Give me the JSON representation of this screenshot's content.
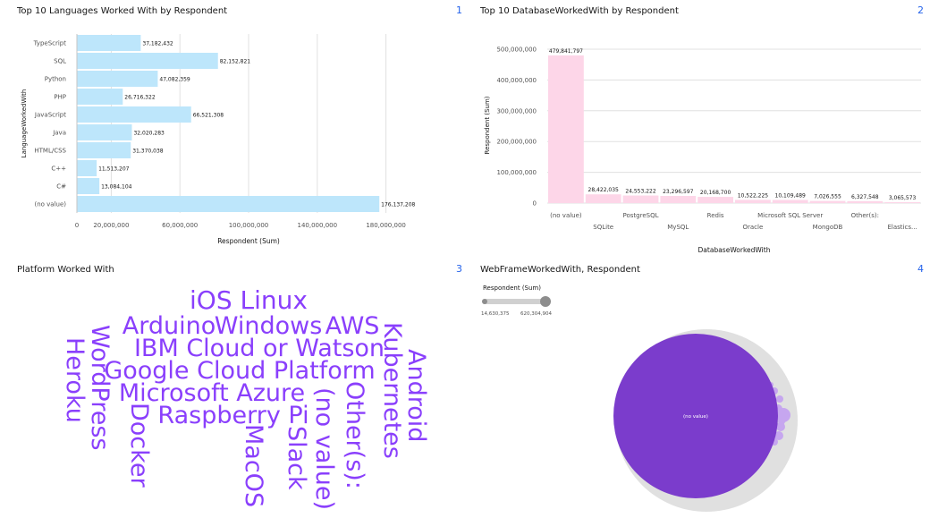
{
  "colors": {
    "bar_blue": "#bde6fb",
    "bar_pink": "#fdd6e8",
    "word_purple": "#8a3ffc",
    "bubble_purple": "#7b3ccc",
    "bubble_light": "#c6a6ef",
    "bubble_outer": "#e0e0e0",
    "panel_number": "#2563eb",
    "grid": "#e0e0e0"
  },
  "panels": [
    {
      "title": "Top 10 Languages Worked With by Respondent",
      "number": "1"
    },
    {
      "title": "Top 10 DatabaseWorkedWith by Respondent",
      "number": "2"
    },
    {
      "title": "Platform Worked With",
      "number": "3"
    },
    {
      "title": "WebFrameWorkedWith, Respondent",
      "number": "4"
    }
  ],
  "chart_data": [
    {
      "type": "bar",
      "orientation": "horizontal",
      "title": "Top 10 Languages Worked With by Respondent",
      "xlabel": "Respondent (Sum)",
      "ylabel": "LanguageWorkedWith",
      "categories": [
        "TypeScript",
        "SQL",
        "Python",
        "PHP",
        "JavaScript",
        "Java",
        "HTML/CSS",
        "C++",
        "C#",
        "(no value)"
      ],
      "values": [
        37182432,
        82152821,
        47082359,
        26716322,
        66521308,
        32020283,
        31370038,
        11513207,
        13084104,
        176137208
      ],
      "value_labels": [
        "37,182,432",
        "82,152,821",
        "47,082,359",
        "26,716,322",
        "66,521,308",
        "32,020,283",
        "31,370,038",
        "11,513,207",
        "13,084,104",
        "176,137,208"
      ],
      "xlim": [
        0,
        200000000
      ],
      "xticks": [
        0,
        20000000,
        60000000,
        100000000,
        140000000,
        180000000
      ],
      "xtick_labels": [
        "0",
        "20,000,000",
        "60,000,000",
        "100,000,000",
        "140,000,000",
        "180,000,000"
      ],
      "grid": true
    },
    {
      "type": "bar",
      "orientation": "vertical",
      "title": "Top 10 DatabaseWorkedWith by Respondent",
      "xlabel": "DatabaseWorkedWith",
      "ylabel": "Respondent (Sum)",
      "categories": [
        "(no value)",
        "SQLite",
        "PostgreSQL",
        "MySQL",
        "Redis",
        "Oracle",
        "Microsoft SQL Server",
        "MongoDB",
        "Other(s):",
        "Elastics..."
      ],
      "values": [
        479841797,
        28422035,
        24553222,
        23296597,
        20168700,
        10522225,
        10109489,
        7026555,
        6327548,
        3065573
      ],
      "value_labels": [
        "479,841,797",
        "28,422,035",
        "24,553,222",
        "23,296,597",
        "20,168,700",
        "10,522,225",
        "10,109,489",
        "7,026,555",
        "6,327,548",
        "3,065,573"
      ],
      "ylim": [
        0,
        500000000
      ],
      "yticks": [
        0,
        100000000,
        200000000,
        300000000,
        400000000,
        500000000
      ],
      "ytick_labels": [
        "0",
        "100,000,000",
        "200,000,000",
        "300,000,000",
        "400,000,000",
        "500,000,000"
      ],
      "grid": true
    },
    {
      "type": "wordcloud",
      "title": "Platform Worked With",
      "words": [
        "iOS",
        "Linux",
        "Arduino",
        "Windows",
        "AWS",
        "IBM Cloud or Watson",
        "Google Cloud Platform",
        "Microsoft Azure",
        "Raspberry Pi",
        "Heroku",
        "WordPress",
        "Docker",
        "MacOS",
        "Slack",
        "(no value)",
        "Other(s):",
        "Kubernetes",
        "Android"
      ]
    },
    {
      "type": "bubble",
      "title": "WebFrameWorkedWith, Respondent",
      "legend_title": "Respondent (Sum)",
      "legend_min": "14,630,375",
      "legend_max": "620,304,904",
      "bubble_label": "(no value)"
    }
  ]
}
